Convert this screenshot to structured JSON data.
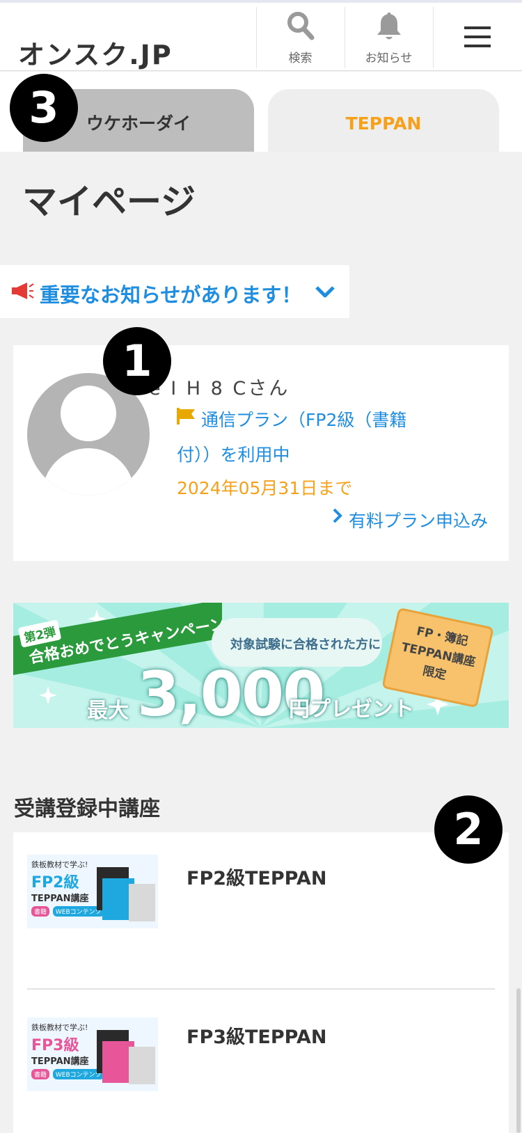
{
  "header": {
    "logo": "オンスク.JP",
    "search_label": "検索",
    "notice_label": "お知らせ"
  },
  "tabs": [
    {
      "label": "ウケホーダイ",
      "active": true
    },
    {
      "label": "TEPPAN",
      "active": false
    }
  ],
  "badges": [
    "1",
    "2",
    "3"
  ],
  "page_title": "マイページ",
  "notice": {
    "text": "重要なお知らせがあります！"
  },
  "profile": {
    "username": "e I H 8 Cさん",
    "plan_line1": "通信プラン（FP2級（書籍",
    "plan_line2": "付））を利用中",
    "expiry": "2024年05月31日まで",
    "upgrade_link": "有料プラン申込み"
  },
  "banner": {
    "tag": "第2弾",
    "campaign": "合格おめでとうキャンペーン",
    "target": "対象試験に合格された方に",
    "max": "最大",
    "amount": "3,000",
    "present": "円プレゼント",
    "ticket": [
      "FP・簿記",
      "TEPPAN講座",
      "限定"
    ]
  },
  "courses_section": {
    "title": "受講登録中講座",
    "items": [
      {
        "name": "FP2級TEPPAN",
        "thumb_tagline": "鉄板教材で学ぶ!",
        "thumb_grade": "FP2級",
        "thumb_sub": "TEPPAN講座",
        "thumb_chip1": "書籍",
        "thumb_chip2": "WEBコンテンツ",
        "thumb_accent": "#1fa8e0"
      },
      {
        "name": "FP3級TEPPAN",
        "thumb_tagline": "鉄板教材で学ぶ!",
        "thumb_grade": "FP3級",
        "thumb_sub": "TEPPAN講座",
        "thumb_chip1": "書籍",
        "thumb_chip2": "WEBコンテンツ",
        "thumb_accent": "#e8569a"
      }
    ]
  },
  "colors": {
    "link_blue": "#1f8de0",
    "accent_orange": "#f5a11b",
    "active_tab": "#bdbdbd",
    "badge": "#000000"
  }
}
